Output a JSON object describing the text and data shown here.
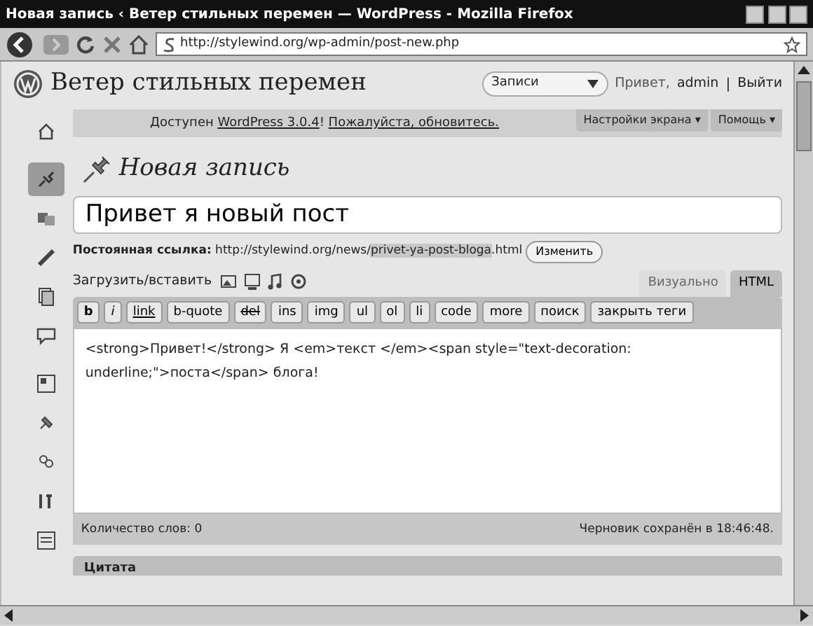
{
  "window": {
    "title": "Новая запись ‹ Ветер стильных перемен — WordPress - Mozilla Firefox"
  },
  "browser": {
    "url": "http://stylewind.org/wp-admin/post-new.php"
  },
  "header": {
    "site_title": "Ветер стильных перемен",
    "favorites": "Записи",
    "greeting": "Привет,",
    "user": "admin",
    "separator": "|",
    "logout": "Выйти"
  },
  "notice": {
    "before": "Доступен",
    "link1": "WordPress 3.0.4",
    "after": "!",
    "link2": "Пожалуйста, обновитесь."
  },
  "screen_tabs": [
    "Настройки экрана ▾",
    "Помощь ▾"
  ],
  "sidebar": {
    "items": [
      {
        "kind": "dashboard",
        "selected": false
      },
      {
        "kind": "posts",
        "selected": true
      },
      {
        "kind": "media",
        "selected": false
      },
      {
        "kind": "links",
        "selected": false
      },
      {
        "kind": "pages",
        "selected": false
      },
      {
        "kind": "comments",
        "selected": false
      },
      {
        "kind": "appearance",
        "selected": false
      },
      {
        "kind": "plugins",
        "selected": false
      },
      {
        "kind": "users",
        "selected": false
      },
      {
        "kind": "tools",
        "selected": false
      },
      {
        "kind": "settings",
        "selected": false
      }
    ]
  },
  "page_title": "Новая запись",
  "post_title": "Привет я новый пост",
  "permalink": {
    "label": "Постоянная ссылка:",
    "base": "http://stylewind.org/news/",
    "slug": "privet-ya-post-bloga",
    "ext": ".html",
    "button": "Изменить"
  },
  "upload": {
    "label": "Загрузить/вставить"
  },
  "editor_tabs": [
    {
      "label": "Визуально",
      "selected": false
    },
    {
      "label": "HTML",
      "selected": true
    }
  ],
  "quicktags": [
    "b",
    "i",
    "link",
    "b-quote",
    "del",
    "ins",
    "img",
    "ul",
    "ol",
    "li",
    "code",
    "more",
    "поиск",
    "закрыть теги"
  ],
  "content": "<strong>Привет!</strong> Я <em>текст </em><span style=\"text-decoration: underline;\">поста</span> блога!",
  "status": {
    "word_count": "Количество слов: 0",
    "draft": "Черновик сохранён в 18:46:48."
  },
  "next_box": {
    "title": "Цитата"
  }
}
